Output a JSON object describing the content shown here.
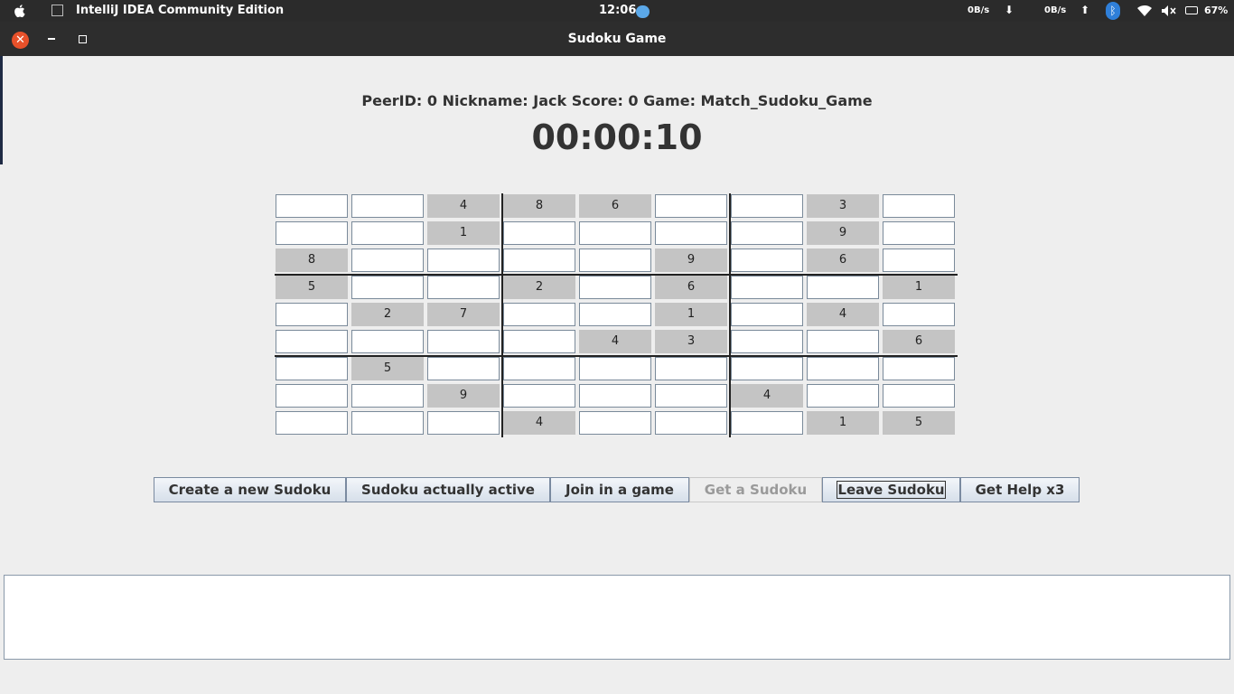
{
  "system_bar": {
    "app_name": "IntelliJ IDEA Community Edition",
    "clock": "12:06",
    "net_down": "0B/s",
    "net_down_arrow": "⬇",
    "net_up": "0B/s",
    "net_up_arrow": "⬆",
    "bluetooth_glyph": "ᛒ",
    "battery": "67%"
  },
  "window": {
    "title": "Sudoku Game",
    "close_glyph": "✕"
  },
  "header": {
    "info": "PeerID: 0  Nickname: Jack  Score: 0 Game: Match_Sudoku_Game",
    "timer": "00:00:10"
  },
  "board": {
    "rows": [
      [
        "",
        "",
        "4",
        "8",
        "6",
        "",
        "",
        "3",
        ""
      ],
      [
        "",
        "",
        "1",
        "",
        "",
        "",
        "",
        "9",
        ""
      ],
      [
        "8",
        "",
        "",
        "",
        "",
        "9",
        "",
        "6",
        ""
      ],
      [
        "5",
        "",
        "",
        "2",
        "",
        "6",
        "",
        "",
        "1"
      ],
      [
        "",
        "2",
        "7",
        "",
        "",
        "1",
        "",
        "4",
        ""
      ],
      [
        "",
        "",
        "",
        "",
        "4",
        "3",
        "",
        "",
        "6"
      ],
      [
        "",
        "5",
        "",
        "",
        "",
        "",
        "",
        "",
        ""
      ],
      [
        "",
        "",
        "9",
        "",
        "",
        "",
        "4",
        "",
        ""
      ],
      [
        "",
        "",
        "",
        "4",
        "",
        "",
        "",
        "1",
        "5"
      ]
    ]
  },
  "buttons": [
    {
      "label": "Create a new Sudoku",
      "enabled": true,
      "focused": false
    },
    {
      "label": "Sudoku actually active",
      "enabled": true,
      "focused": false
    },
    {
      "label": "Join in a game",
      "enabled": true,
      "focused": false
    },
    {
      "label": "Get a Sudoku",
      "enabled": false,
      "focused": false
    },
    {
      "label": "Leave Sudoku",
      "enabled": true,
      "focused": true
    },
    {
      "label": "Get Help x3",
      "enabled": true,
      "focused": false
    }
  ],
  "log_area": {
    "text": ""
  },
  "colors": {
    "given_cell": "#c4c4c4",
    "close_button": "#e8512a",
    "bluetooth": "#2f7fd9"
  }
}
